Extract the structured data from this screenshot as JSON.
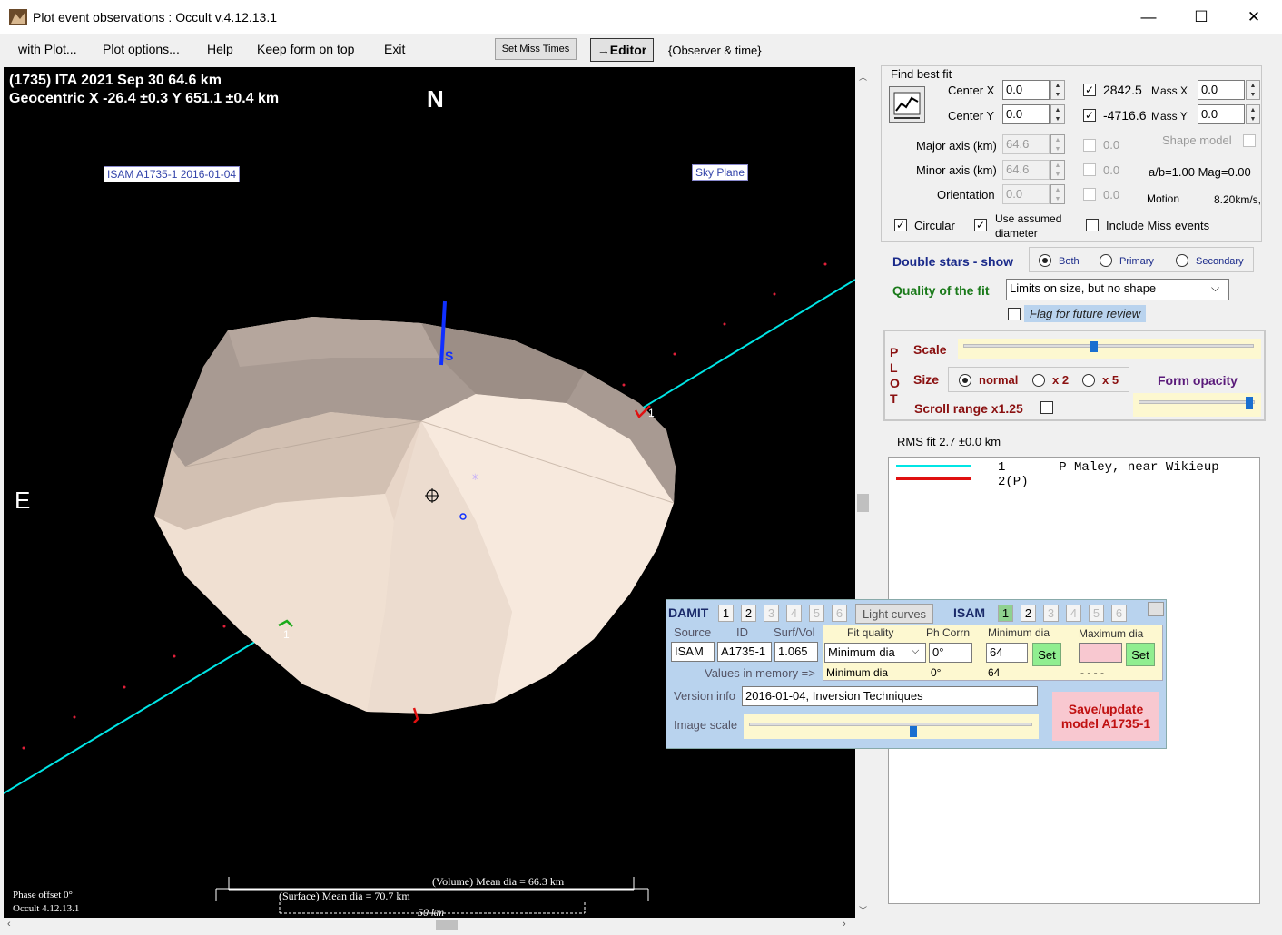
{
  "window": {
    "title": "Plot event observations : Occult v.4.12.13.1",
    "minimize": "—",
    "maximize": "☐",
    "close": "✕"
  },
  "menu": {
    "with_plot": "with Plot...",
    "plot_options": "Plot options...",
    "help": "Help",
    "keep_on_top": "Keep form on top",
    "exit": "Exit",
    "set_miss_times": "Set Miss Times",
    "editor": "→Editor",
    "observer_time": "{Observer & time}"
  },
  "plot": {
    "header_line1": "(1735) ITA  2021 Sep 30   64.6 km",
    "header_line2": "Geocentric  X  -26.4 ±0.3  Y 651.1 ±0.4 km",
    "north": "N",
    "east": "E",
    "model_label": "ISAM A1735-1 2016-01-04",
    "sky_plane": "Sky Plane",
    "pole_label": "S",
    "chord_label_1": "1",
    "chord_label_2": "1",
    "volume_mean": "(Volume) Mean dia = 66.3 km",
    "surface_mean": "(Surface) Mean dia = 70.7 km",
    "scale_bar": "50 km",
    "phase_offset": "Phase offset 0°",
    "version": "Occult 4.12.13.1"
  },
  "fit": {
    "find_best_fit": "Find best fit",
    "center_x_label": "Center X",
    "center_x": "0.0",
    "center_y_label": "Center Y",
    "center_y": "0.0",
    "cx_value": "2842.5",
    "cy_value": "-4716.6",
    "mass_x_label": "Mass X",
    "mass_x": "0.0",
    "mass_y_label": "Mass Y",
    "mass_y": "0.0",
    "major_label": "Major axis (km)",
    "major": "64.6",
    "minor_label": "Minor axis (km)",
    "minor": "64.6",
    "orient_label": "Orientation",
    "orient": "0.0",
    "zero1": "0.0",
    "zero2": "0.0",
    "zero3": "0.0",
    "shape_model": "Shape model",
    "ab": "a/b=1.00  Mag=0.00",
    "motion_label": "Motion",
    "motion": "8.20km/s,",
    "circular": "Circular",
    "use_assumed": "Use assumed",
    "diameter": "diameter",
    "include_miss": "Include Miss events"
  },
  "double_stars": {
    "label": "Double stars - show",
    "both": "Both",
    "primary": "Primary",
    "secondary": "Secondary"
  },
  "quality": {
    "label": "Quality of the fit",
    "value": "Limits on size, but no shape",
    "flag": "Flag for future review"
  },
  "plotbox": {
    "vertical": [
      "P",
      "L",
      "O",
      "T"
    ],
    "scale": "Scale",
    "scale_pos": 0.45,
    "size": "Size",
    "normal": "normal",
    "x2": "x 2",
    "x5": "x 5",
    "form_opacity": "Form opacity",
    "opacity_pos": 0.95,
    "scroll_range": "Scroll range x1.25"
  },
  "rms": "RMS fit 2.7 ±0.0 km",
  "legend": {
    "line1": "1       P Maley, near Wikieup",
    "line2": "2(P)"
  },
  "damit": {
    "damit_label": "DAMIT",
    "damit_nums": [
      "1",
      "2",
      "3",
      "4",
      "5",
      "6"
    ],
    "light_curves": "Light curves",
    "isam_label": "ISAM",
    "isam_nums": [
      "1",
      "2",
      "3",
      "4",
      "5",
      "6"
    ],
    "source_hdr": "Source",
    "id_hdr": "ID",
    "surfvol_hdr": "Surf/Vol",
    "source": "ISAM",
    "id": "A1735-1",
    "surfvol": "1.065",
    "values_in_memory": "Values in memory =>",
    "fit_quality_hdr": "Fit quality",
    "phcorr_hdr": "Ph Corrn",
    "min_dia_hdr": "Minimum dia",
    "max_dia_hdr": "Maximum dia",
    "fit_quality": "Minimum dia",
    "phcorr": "0°",
    "min_dia": "64",
    "max_dia": "",
    "set": "Set",
    "mem_fit": "Minimum dia",
    "mem_ph": "0°",
    "mem_min": "64",
    "mem_max": "- - - -",
    "version_label": "Version info",
    "version": "2016-01-04, Inversion Techniques",
    "image_scale": "Image scale",
    "image_scale_pos": 0.58,
    "save_line1": "Save/update",
    "save_line2": "model A1735-1"
  },
  "colors": {
    "chord1": "#00e5e5",
    "chord2": "#e01010",
    "asteroid_light": "#f2e2d6",
    "asteroid_dark": "#a89a92",
    "damit_bg": "#b9d3ee",
    "plot_bg": "#000000"
  }
}
